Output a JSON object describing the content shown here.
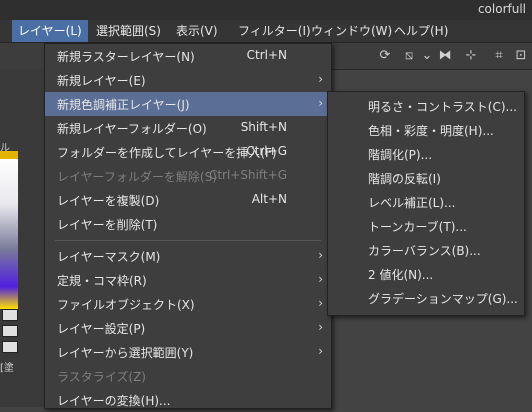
{
  "window": {
    "title": "colorfull"
  },
  "menubar": {
    "items": [
      {
        "label": "レイヤー(L)",
        "active": true
      },
      {
        "label": "選択範囲(S)"
      },
      {
        "label": "表示(V)"
      },
      {
        "label": "フィルター(I)"
      },
      {
        "label": "ウィンドウ(W)"
      },
      {
        "label": "ヘルプ(H)"
      }
    ]
  },
  "left_panel": {
    "label_top": "ル",
    "label_bottom": "[塗"
  },
  "layer_menu": {
    "items": [
      {
        "label": "新規ラスターレイヤー(N)",
        "shortcut": "Ctrl+N"
      },
      {
        "label": "新規レイヤー(E)",
        "submenu": true
      },
      {
        "label": "新規色調補正レイヤー(J)",
        "submenu": true,
        "highlighted": true
      },
      {
        "label": "新規レイヤーフォルダー(O)",
        "shortcut": "Shift+N"
      },
      {
        "label": "フォルダーを作成してレイヤーを挿入(F)",
        "shortcut": "Ctrl+G"
      },
      {
        "label": "レイヤーフォルダーを解除(S)",
        "shortcut": "Ctrl+Shift+G",
        "disabled": true
      },
      {
        "label": "レイヤーを複製(D)",
        "shortcut": "Alt+N"
      },
      {
        "label": "レイヤーを削除(T)"
      },
      {
        "label": "レイヤーマスク(M)",
        "submenu": true
      },
      {
        "label": "定規・コマ枠(R)",
        "submenu": true
      },
      {
        "label": "ファイルオブジェクト(X)",
        "submenu": true
      },
      {
        "label": "レイヤー設定(P)",
        "submenu": true
      },
      {
        "label": "レイヤーから選択範囲(Y)",
        "submenu": true
      },
      {
        "label": "ラスタライズ(Z)",
        "disabled": true
      },
      {
        "label": "レイヤーの変換(H)..."
      }
    ],
    "arrow_glyph": "›"
  },
  "adjustment_submenu": {
    "items": [
      {
        "label": "明るさ・コントラスト(C)..."
      },
      {
        "label": "色相・彩度・明度(H)..."
      },
      {
        "label": "階調化(P)..."
      },
      {
        "label": "階調の反転(I)"
      },
      {
        "label": "レベル補正(L)..."
      },
      {
        "label": "トーンカーブ(T)..."
      },
      {
        "label": "カラーバランス(B)..."
      },
      {
        "label": "2 値化(N)..."
      },
      {
        "label": "グラデーションマップ(G)..."
      }
    ]
  },
  "colors": {
    "highlight": "#5b6f96",
    "menubar_active": "#4a6fa5",
    "menu_bg": "#3e3e3e"
  }
}
